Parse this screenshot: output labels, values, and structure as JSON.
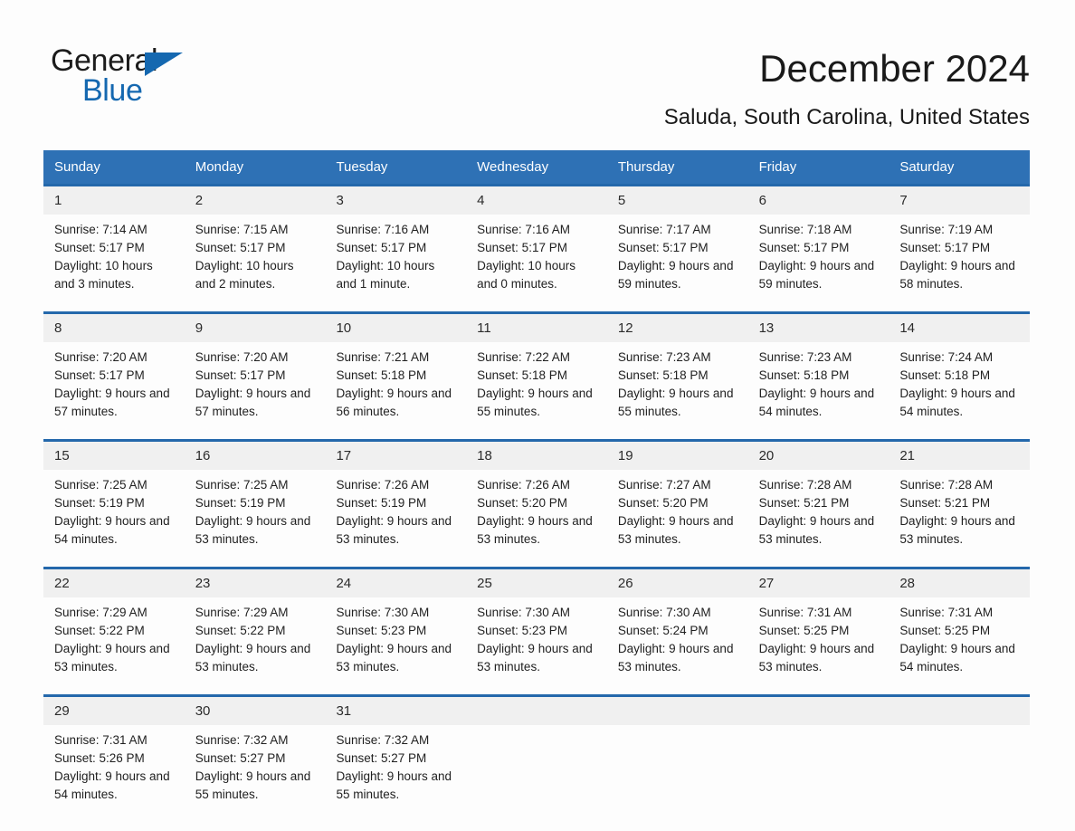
{
  "brand": {
    "name_part1": "General",
    "name_part2": "Blue",
    "accent_color": "#1568b0",
    "triangle_icon": "brand-triangle-icon"
  },
  "header": {
    "month_title": "December 2024",
    "location": "Saluda, South Carolina, United States"
  },
  "calendar": {
    "header_bg_color": "#2e71b5",
    "row_border_color": "#2468ab",
    "day_band_color": "#f0f0f0",
    "weekdays": [
      "Sunday",
      "Monday",
      "Tuesday",
      "Wednesday",
      "Thursday",
      "Friday",
      "Saturday"
    ],
    "weeks": [
      [
        {
          "day": "1",
          "sunrise": "Sunrise: 7:14 AM",
          "sunset": "Sunset: 5:17 PM",
          "daylight": "Daylight: 10 hours and 3 minutes."
        },
        {
          "day": "2",
          "sunrise": "Sunrise: 7:15 AM",
          "sunset": "Sunset: 5:17 PM",
          "daylight": "Daylight: 10 hours and 2 minutes."
        },
        {
          "day": "3",
          "sunrise": "Sunrise: 7:16 AM",
          "sunset": "Sunset: 5:17 PM",
          "daylight": "Daylight: 10 hours and 1 minute."
        },
        {
          "day": "4",
          "sunrise": "Sunrise: 7:16 AM",
          "sunset": "Sunset: 5:17 PM",
          "daylight": "Daylight: 10 hours and 0 minutes."
        },
        {
          "day": "5",
          "sunrise": "Sunrise: 7:17 AM",
          "sunset": "Sunset: 5:17 PM",
          "daylight": "Daylight: 9 hours and 59 minutes."
        },
        {
          "day": "6",
          "sunrise": "Sunrise: 7:18 AM",
          "sunset": "Sunset: 5:17 PM",
          "daylight": "Daylight: 9 hours and 59 minutes."
        },
        {
          "day": "7",
          "sunrise": "Sunrise: 7:19 AM",
          "sunset": "Sunset: 5:17 PM",
          "daylight": "Daylight: 9 hours and 58 minutes."
        }
      ],
      [
        {
          "day": "8",
          "sunrise": "Sunrise: 7:20 AM",
          "sunset": "Sunset: 5:17 PM",
          "daylight": "Daylight: 9 hours and 57 minutes."
        },
        {
          "day": "9",
          "sunrise": "Sunrise: 7:20 AM",
          "sunset": "Sunset: 5:17 PM",
          "daylight": "Daylight: 9 hours and 57 minutes."
        },
        {
          "day": "10",
          "sunrise": "Sunrise: 7:21 AM",
          "sunset": "Sunset: 5:18 PM",
          "daylight": "Daylight: 9 hours and 56 minutes."
        },
        {
          "day": "11",
          "sunrise": "Sunrise: 7:22 AM",
          "sunset": "Sunset: 5:18 PM",
          "daylight": "Daylight: 9 hours and 55 minutes."
        },
        {
          "day": "12",
          "sunrise": "Sunrise: 7:23 AM",
          "sunset": "Sunset: 5:18 PM",
          "daylight": "Daylight: 9 hours and 55 minutes."
        },
        {
          "day": "13",
          "sunrise": "Sunrise: 7:23 AM",
          "sunset": "Sunset: 5:18 PM",
          "daylight": "Daylight: 9 hours and 54 minutes."
        },
        {
          "day": "14",
          "sunrise": "Sunrise: 7:24 AM",
          "sunset": "Sunset: 5:18 PM",
          "daylight": "Daylight: 9 hours and 54 minutes."
        }
      ],
      [
        {
          "day": "15",
          "sunrise": "Sunrise: 7:25 AM",
          "sunset": "Sunset: 5:19 PM",
          "daylight": "Daylight: 9 hours and 54 minutes."
        },
        {
          "day": "16",
          "sunrise": "Sunrise: 7:25 AM",
          "sunset": "Sunset: 5:19 PM",
          "daylight": "Daylight: 9 hours and 53 minutes."
        },
        {
          "day": "17",
          "sunrise": "Sunrise: 7:26 AM",
          "sunset": "Sunset: 5:19 PM",
          "daylight": "Daylight: 9 hours and 53 minutes."
        },
        {
          "day": "18",
          "sunrise": "Sunrise: 7:26 AM",
          "sunset": "Sunset: 5:20 PM",
          "daylight": "Daylight: 9 hours and 53 minutes."
        },
        {
          "day": "19",
          "sunrise": "Sunrise: 7:27 AM",
          "sunset": "Sunset: 5:20 PM",
          "daylight": "Daylight: 9 hours and 53 minutes."
        },
        {
          "day": "20",
          "sunrise": "Sunrise: 7:28 AM",
          "sunset": "Sunset: 5:21 PM",
          "daylight": "Daylight: 9 hours and 53 minutes."
        },
        {
          "day": "21",
          "sunrise": "Sunrise: 7:28 AM",
          "sunset": "Sunset: 5:21 PM",
          "daylight": "Daylight: 9 hours and 53 minutes."
        }
      ],
      [
        {
          "day": "22",
          "sunrise": "Sunrise: 7:29 AM",
          "sunset": "Sunset: 5:22 PM",
          "daylight": "Daylight: 9 hours and 53 minutes."
        },
        {
          "day": "23",
          "sunrise": "Sunrise: 7:29 AM",
          "sunset": "Sunset: 5:22 PM",
          "daylight": "Daylight: 9 hours and 53 minutes."
        },
        {
          "day": "24",
          "sunrise": "Sunrise: 7:30 AM",
          "sunset": "Sunset: 5:23 PM",
          "daylight": "Daylight: 9 hours and 53 minutes."
        },
        {
          "day": "25",
          "sunrise": "Sunrise: 7:30 AM",
          "sunset": "Sunset: 5:23 PM",
          "daylight": "Daylight: 9 hours and 53 minutes."
        },
        {
          "day": "26",
          "sunrise": "Sunrise: 7:30 AM",
          "sunset": "Sunset: 5:24 PM",
          "daylight": "Daylight: 9 hours and 53 minutes."
        },
        {
          "day": "27",
          "sunrise": "Sunrise: 7:31 AM",
          "sunset": "Sunset: 5:25 PM",
          "daylight": "Daylight: 9 hours and 53 minutes."
        },
        {
          "day": "28",
          "sunrise": "Sunrise: 7:31 AM",
          "sunset": "Sunset: 5:25 PM",
          "daylight": "Daylight: 9 hours and 54 minutes."
        }
      ],
      [
        {
          "day": "29",
          "sunrise": "Sunrise: 7:31 AM",
          "sunset": "Sunset: 5:26 PM",
          "daylight": "Daylight: 9 hours and 54 minutes."
        },
        {
          "day": "30",
          "sunrise": "Sunrise: 7:32 AM",
          "sunset": "Sunset: 5:27 PM",
          "daylight": "Daylight: 9 hours and 55 minutes."
        },
        {
          "day": "31",
          "sunrise": "Sunrise: 7:32 AM",
          "sunset": "Sunset: 5:27 PM",
          "daylight": "Daylight: 9 hours and 55 minutes."
        },
        {
          "day": "",
          "sunrise": "",
          "sunset": "",
          "daylight": ""
        },
        {
          "day": "",
          "sunrise": "",
          "sunset": "",
          "daylight": ""
        },
        {
          "day": "",
          "sunrise": "",
          "sunset": "",
          "daylight": ""
        },
        {
          "day": "",
          "sunrise": "",
          "sunset": "",
          "daylight": ""
        }
      ]
    ]
  }
}
